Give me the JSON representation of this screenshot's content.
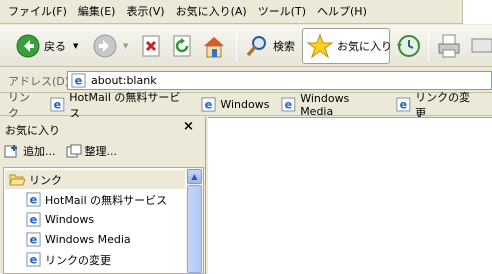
{
  "menubar": {
    "items": [
      "ファイル(F)",
      "編集(E)",
      "表示(V)",
      "お気に入り(A)",
      "ツール(T)",
      "ヘルプ(H)"
    ]
  },
  "toolbar": {
    "back_label": "戻る",
    "search_label": "検索",
    "favorites_label": "お気に入り"
  },
  "address": {
    "label": "アドレス(D)",
    "value": "about:blank"
  },
  "links": {
    "label": "リンク",
    "items": [
      "HotMail の無料サービス",
      "Windows",
      "Windows Media",
      "リンクの変更"
    ]
  },
  "favorites": {
    "title": "お気に入り",
    "close": "×",
    "add_label": "追加...",
    "organize_label": "整理...",
    "folder_label": "リンク",
    "items": [
      "HotMail の無料サービス",
      "Windows",
      "Windows Media",
      "リンクの変更"
    ]
  },
  "colors": {
    "accent": "#316ac5",
    "folder": "#f5d46b"
  }
}
